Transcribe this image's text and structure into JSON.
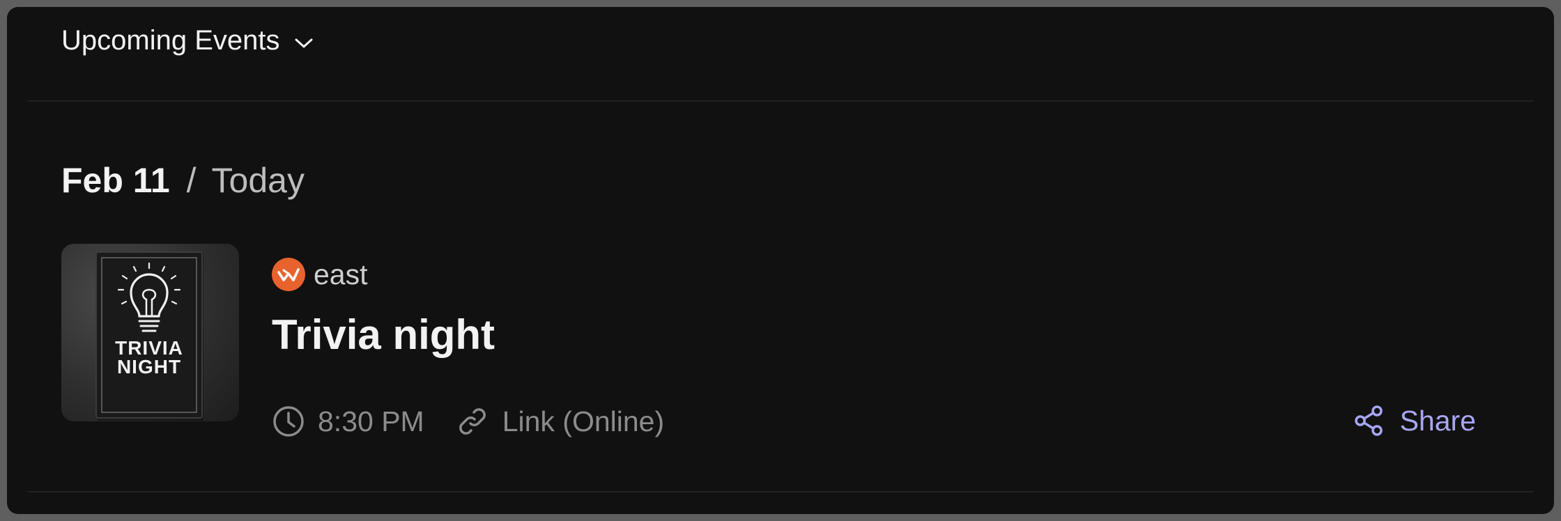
{
  "header": {
    "title": "Upcoming Events",
    "dropdown_icon": "chevron-down-icon"
  },
  "date_group": {
    "date": "Feb 11",
    "separator": "/",
    "relative": "Today"
  },
  "event": {
    "thumbnail": {
      "line1": "TRIVIA",
      "line2": "NIGHT",
      "icon": "lightbulb-icon"
    },
    "organizer": {
      "name": "east",
      "logo_color": "#e8622e"
    },
    "title": "Trivia night",
    "time": "8:30 PM",
    "location": "Link (Online)",
    "share_label": "Share"
  },
  "colors": {
    "background": "#111111",
    "frame": "#5f5f5f",
    "accent": "#a8a6f2",
    "muted": "#8c8c8c"
  }
}
